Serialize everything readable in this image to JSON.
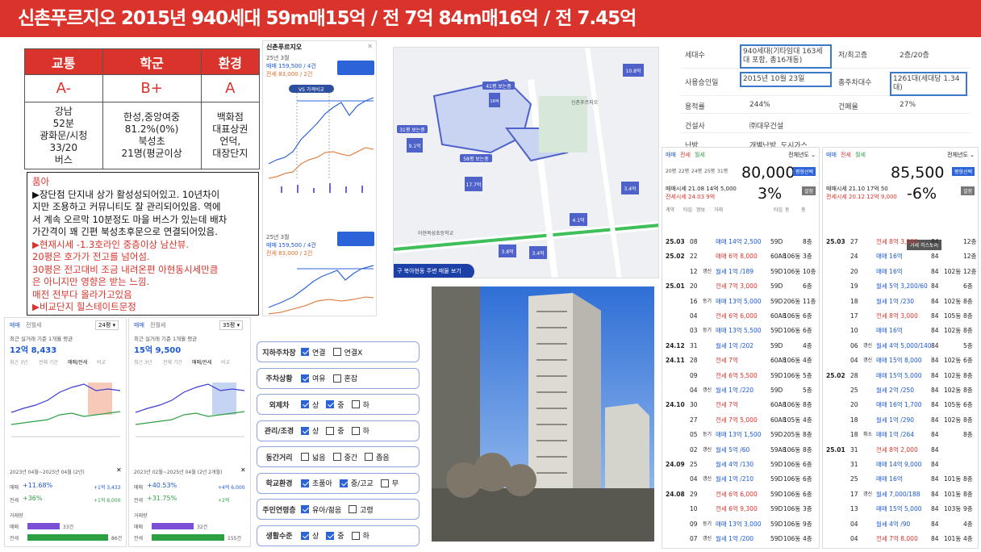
{
  "header": {
    "title": "신촌푸르지오 2015년 940세대 59m매15억 / 전 7억 84m매16억 / 전 7.45억"
  },
  "rating": {
    "headers": [
      "교통",
      "학군",
      "환경"
    ],
    "grades": [
      "A-",
      "B+",
      "A"
    ],
    "details": [
      "강남\n52분\n광화문/시청\n33/20\n버스",
      "한성,중앙여중\n81.2%(0%)\n북성초\n21명(평균이상",
      "백화점\n대표상권\n언덕,\n대장단지"
    ]
  },
  "memo": {
    "lines": [
      {
        "t": "품아",
        "red": true
      },
      {
        "t": "▶장단점 단지내 상가 활성성되어있고. 10년차이",
        "red": false
      },
      {
        "t": "지만 조용하고 커뮤니티도 잘 관리되어있음. 역에",
        "red": false
      },
      {
        "t": "서 계속 오르막 10분정도 마을 버스가 있는데 배차",
        "red": false
      },
      {
        "t": "가간격이 꽤 긴편 북성초후문으로 연결되어있음.",
        "red": false
      },
      {
        "t": "▶현재시세 -1.3호라인 중층이상 남산뷰.",
        "red": true
      },
      {
        "t": "20평은 호가가 전고를 넘어섬.",
        "red": true
      },
      {
        "t": "30평은 전고대비 조금 내려온편 아현동시세만큼",
        "red": true
      },
      {
        "t": "은 아니지만 영향은 받는 느낌.",
        "red": true
      },
      {
        "t": "매전 전부다 올라가고있음",
        "red": true
      },
      {
        "t": " ▶비교단지 힐스테이트문정",
        "red": true
      }
    ]
  },
  "phone1": {
    "title": "신촌푸르지오",
    "top_label": "25년 3월",
    "top_price": "매매 159,500 / 4건",
    "top_jeonse": "전세 83,000 / 2건",
    "bottom_label": "25년 3월",
    "bottom_price": "매매 159,500 / 4건",
    "bottom_jeonse": "전세 83,000 / 2건",
    "tag": "VS 가격비교"
  },
  "map": {
    "labels": [
      "41평 보는중",
      "16억",
      "31평 보는중",
      "9.1억",
      "58평 보는중",
      "17.7억",
      "10.8억",
      "3.4억",
      "4.1억",
      "3.8억",
      "3.4억",
      "신촌푸르지오"
    ],
    "button": "구 북아현동 주변 매물 보기",
    "area_text": "아현북성초등학교"
  },
  "ratio_cards": [
    {
      "tab1": "매매",
      "tab2": "전월세",
      "select": "24평",
      "title": "최근 실거래 기준 1개월 평균",
      "price": "12억 8,433",
      "sub_tabs": [
        "최근 3년",
        "전체 기간",
        "매매/전세",
        "비교"
      ],
      "range": "2023년 04월~2025년 04월 (2년)",
      "rate1": "+11.68%",
      "rate1_side": "+1억 3,433",
      "rate2": "+36%",
      "rate2_side": "+1억 8,000",
      "vol_title": "거래량",
      "vol1": "33건",
      "vol2": "86건",
      "label1": "매매",
      "label2": "전세"
    },
    {
      "tab1": "매매",
      "tab2": "전월세",
      "select": "35평",
      "title": "최근 실거래 기준 1개월 평균",
      "price": "15억 9,500",
      "sub_tabs": [
        "최근 3년",
        "전체 기간",
        "매매/전세",
        "비교"
      ],
      "range": "2023년 02월~2025년 04월 (2년 2개월)",
      "rate1": "+40.53%",
      "rate1_side": "+4억 6,000",
      "rate2": "+31.75%",
      "rate2_side": "+2억",
      "vol_title": "거래량",
      "vol1": "32건",
      "vol2": "155건",
      "label1": "매매",
      "label2": "전세"
    }
  ],
  "checklist": [
    {
      "label": "지하주차장",
      "opts": [
        {
          "t": "연결",
          "on": true
        },
        {
          "t": "연결X",
          "on": false
        }
      ]
    },
    {
      "label": "주차상황",
      "opts": [
        {
          "t": "여유",
          "on": true
        },
        {
          "t": "혼잡",
          "on": false
        }
      ]
    },
    {
      "label": "외제차",
      "opts": [
        {
          "t": "상",
          "on": true
        },
        {
          "t": "중",
          "on": true
        },
        {
          "t": "하",
          "on": false
        }
      ]
    },
    {
      "label": "관리/조경",
      "opts": [
        {
          "t": "상",
          "on": true
        },
        {
          "t": "중",
          "on": false
        },
        {
          "t": "하",
          "on": false
        }
      ]
    },
    {
      "label": "동간거리",
      "opts": [
        {
          "t": "넓음",
          "on": false
        },
        {
          "t": "중간",
          "on": false
        },
        {
          "t": "좁음",
          "on": false
        }
      ]
    },
    {
      "label": "학교환경",
      "opts": [
        {
          "t": "초품아",
          "on": true
        },
        {
          "t": "중/고교",
          "on": true
        },
        {
          "t": "무",
          "on": false
        }
      ]
    },
    {
      "label": "주민연령층",
      "opts": [
        {
          "t": "유아/젊음",
          "on": true
        },
        {
          "t": "고령",
          "on": false
        }
      ]
    },
    {
      "label": "생활수준",
      "opts": [
        {
          "t": "상",
          "on": true
        },
        {
          "t": "중",
          "on": true
        },
        {
          "t": "하",
          "on": false
        }
      ]
    }
  ],
  "info": {
    "rows": [
      {
        "k1": "세대수",
        "v1": "940세대(기타임대 163세대 포함, 총16개동)",
        "k2": "저/최고층",
        "v2": "2층/20층"
      },
      {
        "k1": "사용승인일",
        "v1": "2015년 10월 23일",
        "k2": "총주차대수",
        "v2": "1261대(세대당 1.34대)"
      },
      {
        "k1": "용적률",
        "v1": "244%",
        "k2": "건폐율",
        "v2": "27%"
      },
      {
        "k1": "건설사",
        "v1": "㈜대우건설",
        "k2": "",
        "v2": ""
      },
      {
        "k1": "난방",
        "v1": "개별난방, 도시가스",
        "k2": "",
        "v2": ""
      }
    ]
  },
  "trade_left": {
    "tabs": [
      "매매",
      "전세",
      "월세"
    ],
    "filter": "전체년도",
    "sizes": [
      "20평",
      "22평",
      "24평",
      "25평",
      "31평"
    ],
    "big": "80,000",
    "pct": "3%",
    "btn1": "평형선택",
    "btn2": "설정",
    "stat1": "매매시세 21.08 14억 5,000",
    "stat2": "전세시세 24.03 9억",
    "cols": [
      "계약",
      "타입",
      "정보",
      "거래",
      "타입",
      "동",
      "층"
    ],
    "rows": [
      {
        "ym": "25.03",
        "d": "08",
        "k": "",
        "price": "매매 14억 2,500",
        "ty": "59D",
        "dong": "",
        "fl": "8층",
        "c": "blue"
      },
      {
        "ym": "25.02",
        "d": "22",
        "k": "",
        "price": "매매 6억 8,000",
        "ty": "60A8",
        "dong": "106동",
        "fl": "3층",
        "c": "red"
      },
      {
        "ym": "",
        "d": "12",
        "k": "갱신",
        "price": "월세 1억 /189",
        "ty": "59D",
        "dong": "106동",
        "fl": "10층",
        "c": "blue"
      },
      {
        "ym": "25.01",
        "d": "20",
        "k": "",
        "price": "전세 7억 3,000",
        "ty": "59D",
        "dong": "",
        "fl": "6층",
        "c": "red"
      },
      {
        "ym": "",
        "d": "16",
        "k": "등기",
        "price": "매매 13억 5,000",
        "ty": "59D",
        "dong": "206동",
        "fl": "11층",
        "c": "blue"
      },
      {
        "ym": "",
        "d": "04",
        "k": "",
        "price": "전세 6억 6,000",
        "ty": "60A8",
        "dong": "106동",
        "fl": "6층",
        "c": "red"
      },
      {
        "ym": "",
        "d": "03",
        "k": "등기",
        "price": "매매 13억 5,500",
        "ty": "59D",
        "dong": "106동",
        "fl": "6층",
        "c": "blue"
      },
      {
        "ym": "24.12",
        "d": "31",
        "k": "",
        "price": "월세 1억 /202",
        "ty": "59D",
        "dong": "",
        "fl": "4층",
        "c": "blue"
      },
      {
        "ym": "24.11",
        "d": "28",
        "k": "",
        "price": "전세 7억",
        "ty": "60A8",
        "dong": "106동",
        "fl": "4층",
        "c": "red"
      },
      {
        "ym": "",
        "d": "09",
        "k": "",
        "price": "전세 6억 5,500",
        "ty": "59D",
        "dong": "106동",
        "fl": "5층",
        "c": "red"
      },
      {
        "ym": "",
        "d": "04",
        "k": "갱신",
        "price": "월세 1억 /220",
        "ty": "59D",
        "dong": "",
        "fl": "5층",
        "c": "blue"
      },
      {
        "ym": "24.10",
        "d": "30",
        "k": "",
        "price": "전세 7억",
        "ty": "60A8",
        "dong": "106동",
        "fl": "8층",
        "c": "red"
      },
      {
        "ym": "",
        "d": "27",
        "k": "",
        "price": "전세 7억 5,000",
        "ty": "60A8",
        "dong": "105동",
        "fl": "4층",
        "c": "red"
      },
      {
        "ym": "",
        "d": "05",
        "k": "등기",
        "price": "매매 13억 1,500",
        "ty": "59D",
        "dong": "205동",
        "fl": "8층",
        "c": "blue"
      },
      {
        "ym": "",
        "d": "02",
        "k": "갱신",
        "price": "월세 5억 /60",
        "ty": "59A8",
        "dong": "106동",
        "fl": "8층",
        "c": "blue"
      },
      {
        "ym": "24.09",
        "d": "25",
        "k": "",
        "price": "월세 4억 /130",
        "ty": "59D",
        "dong": "106동",
        "fl": "6층",
        "c": "blue"
      },
      {
        "ym": "",
        "d": "04",
        "k": "갱신",
        "price": "월세 1억 /210",
        "ty": "59D",
        "dong": "106동",
        "fl": "6층",
        "c": "blue"
      },
      {
        "ym": "24.08",
        "d": "29",
        "k": "",
        "price": "전세 6억 6,000",
        "ty": "59D",
        "dong": "106동",
        "fl": "6층",
        "c": "red"
      },
      {
        "ym": "",
        "d": "10",
        "k": "",
        "price": "전세 6억 9,300",
        "ty": "59D",
        "dong": "106동",
        "fl": "3층",
        "c": "red"
      },
      {
        "ym": "",
        "d": "09",
        "k": "등기",
        "price": "매매 13억 3,000",
        "ty": "59D",
        "dong": "106동",
        "fl": "9층",
        "c": "blue"
      },
      {
        "ym": "",
        "d": "07",
        "k": "갱신",
        "price": "월세 1억 /200",
        "ty": "59D",
        "dong": "106동",
        "fl": "4층",
        "c": "blue"
      }
    ]
  },
  "trade_right": {
    "tabs": [
      "매매",
      "전세",
      "월세"
    ],
    "filter": "전체년도",
    "big": "85,500",
    "pct": "-6%",
    "btn1": "평형선택",
    "btn2": "설정",
    "stat1": "매매시세 21.10 17억 50",
    "stat2": "전세시세 20.12 12억 9,000",
    "tooltip": "거래 히스토리",
    "rows": [
      {
        "ym": "25.03",
        "d": "27",
        "k": "",
        "price": "전세 8억 3,000",
        "ty": "84",
        "dong": "",
        "fl": "12층",
        "c": "red"
      },
      {
        "ym": "",
        "d": "24",
        "k": "",
        "price": "매매 16억",
        "ty": "84",
        "dong": "",
        "fl": "12층",
        "c": "blue"
      },
      {
        "ym": "",
        "d": "20",
        "k": "",
        "price": "매매 16억",
        "ty": "84",
        "dong": "102동",
        "fl": "12층",
        "c": "blue"
      },
      {
        "ym": "",
        "d": "19",
        "k": "",
        "price": "월세 5억 3,200/60",
        "ty": "84",
        "dong": "",
        "fl": "6층",
        "c": "blue"
      },
      {
        "ym": "",
        "d": "18",
        "k": "",
        "price": "월세 1억 /230",
        "ty": "84",
        "dong": "102동",
        "fl": "8층",
        "c": "blue"
      },
      {
        "ym": "",
        "d": "17",
        "k": "",
        "price": "전세 8억 3,000",
        "ty": "84",
        "dong": "105동",
        "fl": "8층",
        "c": "red"
      },
      {
        "ym": "",
        "d": "10",
        "k": "",
        "price": "매매 16억",
        "ty": "84",
        "dong": "102동",
        "fl": "8층",
        "c": "blue"
      },
      {
        "ym": "",
        "d": "06",
        "k": "갱신",
        "price": "월세 4억 5,000/140",
        "ty": "84",
        "dong": "",
        "fl": "5층",
        "c": "blue"
      },
      {
        "ym": "",
        "d": "04",
        "k": "갱신",
        "price": "매매 15억 8,000",
        "ty": "84",
        "dong": "102동",
        "fl": "6층",
        "c": "blue"
      },
      {
        "ym": "25.02",
        "d": "28",
        "k": "",
        "price": "매매 15억 5,000",
        "ty": "84",
        "dong": "102동",
        "fl": "8층",
        "c": "blue"
      },
      {
        "ym": "",
        "d": "25",
        "k": "",
        "price": "월세 2억 /250",
        "ty": "84",
        "dong": "102동",
        "fl": "8층",
        "c": "blue"
      },
      {
        "ym": "",
        "d": "20",
        "k": "",
        "price": "매매 16억 1,700",
        "ty": "84",
        "dong": "105동",
        "fl": "6층",
        "c": "blue"
      },
      {
        "ym": "",
        "d": "18",
        "k": "",
        "price": "월세 1억 /290",
        "ty": "84",
        "dong": "102동",
        "fl": "8층",
        "c": "blue"
      },
      {
        "ym": "",
        "d": "18",
        "k": "취소",
        "price": "매매 1억 /264",
        "ty": "84",
        "dong": "",
        "fl": "8층",
        "c": "blue"
      },
      {
        "ym": "25.01",
        "d": "31",
        "k": "",
        "price": "전세 8억 2,000",
        "ty": "84",
        "dong": "",
        "fl": "",
        "c": "red"
      },
      {
        "ym": "",
        "d": "31",
        "k": "",
        "price": "매매 14억 9,000",
        "ty": "84",
        "dong": "",
        "fl": "",
        "c": "blue"
      },
      {
        "ym": "",
        "d": "25",
        "k": "",
        "price": "매매 16억",
        "ty": "84",
        "dong": "101동",
        "fl": "8층",
        "c": "blue"
      },
      {
        "ym": "",
        "d": "17",
        "k": "갱신",
        "price": "월세 7,000/188",
        "ty": "84",
        "dong": "101동",
        "fl": "8층",
        "c": "blue"
      },
      {
        "ym": "",
        "d": "13",
        "k": "",
        "price": "매매 15억 5,000",
        "ty": "84",
        "dong": "103동",
        "fl": "9층",
        "c": "blue"
      },
      {
        "ym": "",
        "d": "04",
        "k": "",
        "price": "월세 4억 /90",
        "ty": "84",
        "dong": "",
        "fl": "4층",
        "c": "blue"
      },
      {
        "ym": "",
        "d": "04",
        "k": "",
        "price": "전세 7억 8,000",
        "ty": "84",
        "dong": "101동",
        "fl": "4층",
        "c": "red"
      }
    ]
  }
}
